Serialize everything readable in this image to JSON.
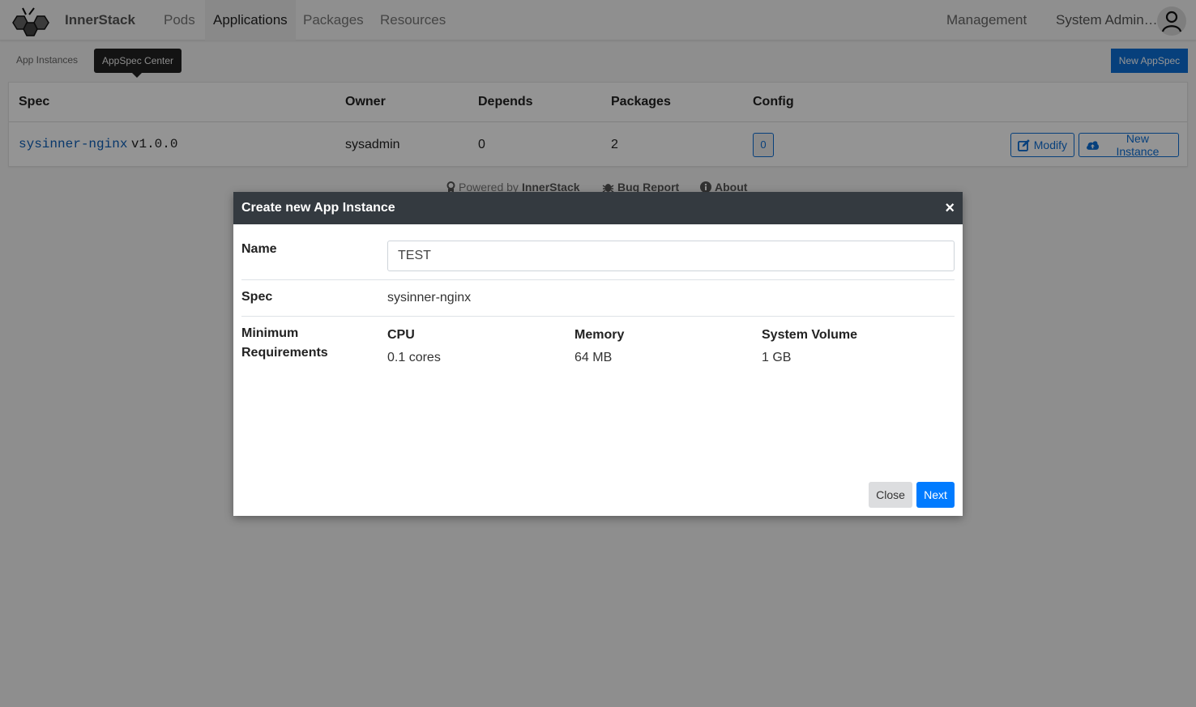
{
  "app": {
    "brand": "InnerStack",
    "nav": [
      {
        "label": "Pods",
        "active": false
      },
      {
        "label": "Applications",
        "active": true
      },
      {
        "label": "Packages",
        "active": false
      },
      {
        "label": "Resources",
        "active": false
      }
    ],
    "management": "Management",
    "user_name": "System Admin…",
    "avatar_icon": "user-icon"
  },
  "subnav": {
    "links": [
      "App Instances",
      "AppSpec Center"
    ],
    "tooltip": "AppSpec Center",
    "new_appspec_label": "New AppSpec"
  },
  "table": {
    "headers": [
      "Spec",
      "Owner",
      "Depends",
      "Packages",
      "Config"
    ],
    "rows": [
      {
        "spec_name": "sysinner-nginx",
        "spec_version": "v1.0.0",
        "owner": "sysadmin",
        "depends": "0",
        "packages": "2",
        "config": "0",
        "modify_label": "Modify",
        "new_instance_label": "New Instance"
      }
    ]
  },
  "footer": {
    "powered_prefix": "Powered by",
    "powered_brand": "InnerStack",
    "bug_report": "Bug Report",
    "about": "About"
  },
  "modal": {
    "title": "Create new App Instance",
    "close_symbol": "×",
    "name_label": "Name",
    "name_value": "TEST",
    "spec_label": "Spec",
    "spec_value": "sysinner-nginx",
    "req_label_line1": "Minimum",
    "req_label_line2": "Requirements",
    "requirements": [
      {
        "label": "CPU",
        "value": "0.1 cores"
      },
      {
        "label": "Memory",
        "value": "64 MB"
      },
      {
        "label": "System Volume",
        "value": "1 GB"
      }
    ],
    "close_label": "Close",
    "next_label": "Next"
  },
  "colors": {
    "primary": "#007bff",
    "link": "#0d5fb8",
    "modal_header": "#343a40"
  }
}
